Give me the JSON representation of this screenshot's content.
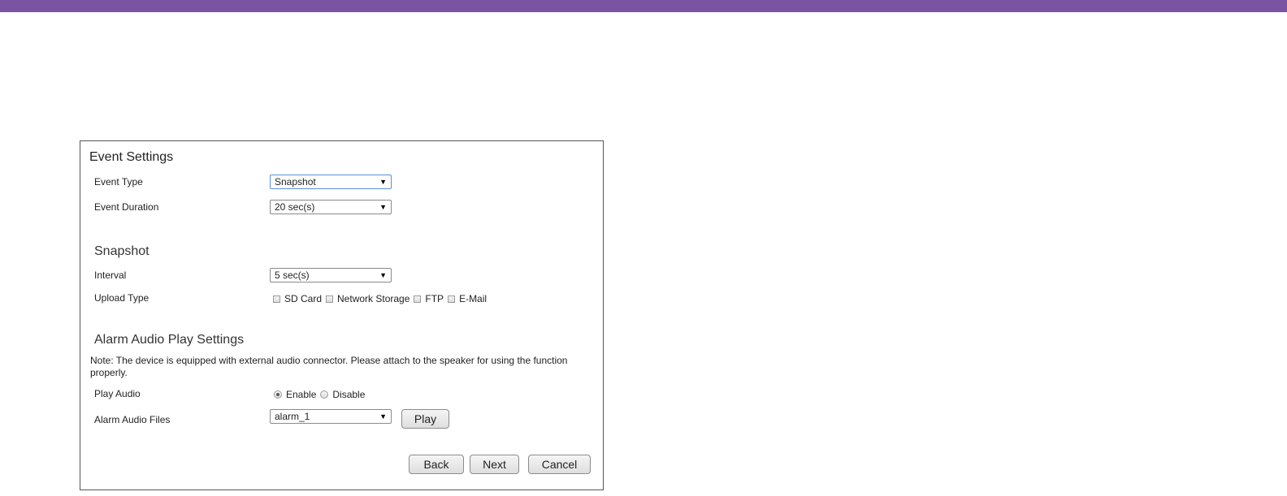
{
  "event_settings": {
    "title": "Event Settings",
    "event_type": {
      "label": "Event Type",
      "value": "Snapshot"
    },
    "event_duration": {
      "label": "Event Duration",
      "value": "20 sec(s)"
    }
  },
  "snapshot": {
    "title": "Snapshot",
    "interval": {
      "label": "Interval",
      "value": "5 sec(s)"
    },
    "upload_type": {
      "label": "Upload Type",
      "options": [
        {
          "label": "SD Card",
          "checked": false
        },
        {
          "label": "Network Storage",
          "checked": false
        },
        {
          "label": "FTP",
          "checked": false
        },
        {
          "label": "E-Mail",
          "checked": false
        }
      ]
    }
  },
  "alarm_audio": {
    "title": "Alarm Audio Play Settings",
    "note": "Note: The device is equipped with external audio connector. Please attach to the speaker for using the function properly.",
    "play_audio": {
      "label": "Play Audio",
      "enable_label": "Enable",
      "disable_label": "Disable",
      "selected": "Enable"
    },
    "audio_files": {
      "label": "Alarm Audio Files",
      "value": "alarm_1",
      "play_label": "Play"
    }
  },
  "footer": {
    "back_label": "Back",
    "next_label": "Next",
    "cancel_label": "Cancel"
  },
  "icons": {
    "dropdown_arrow": "▼"
  },
  "colors": {
    "top_bar": "#7b53a3"
  }
}
